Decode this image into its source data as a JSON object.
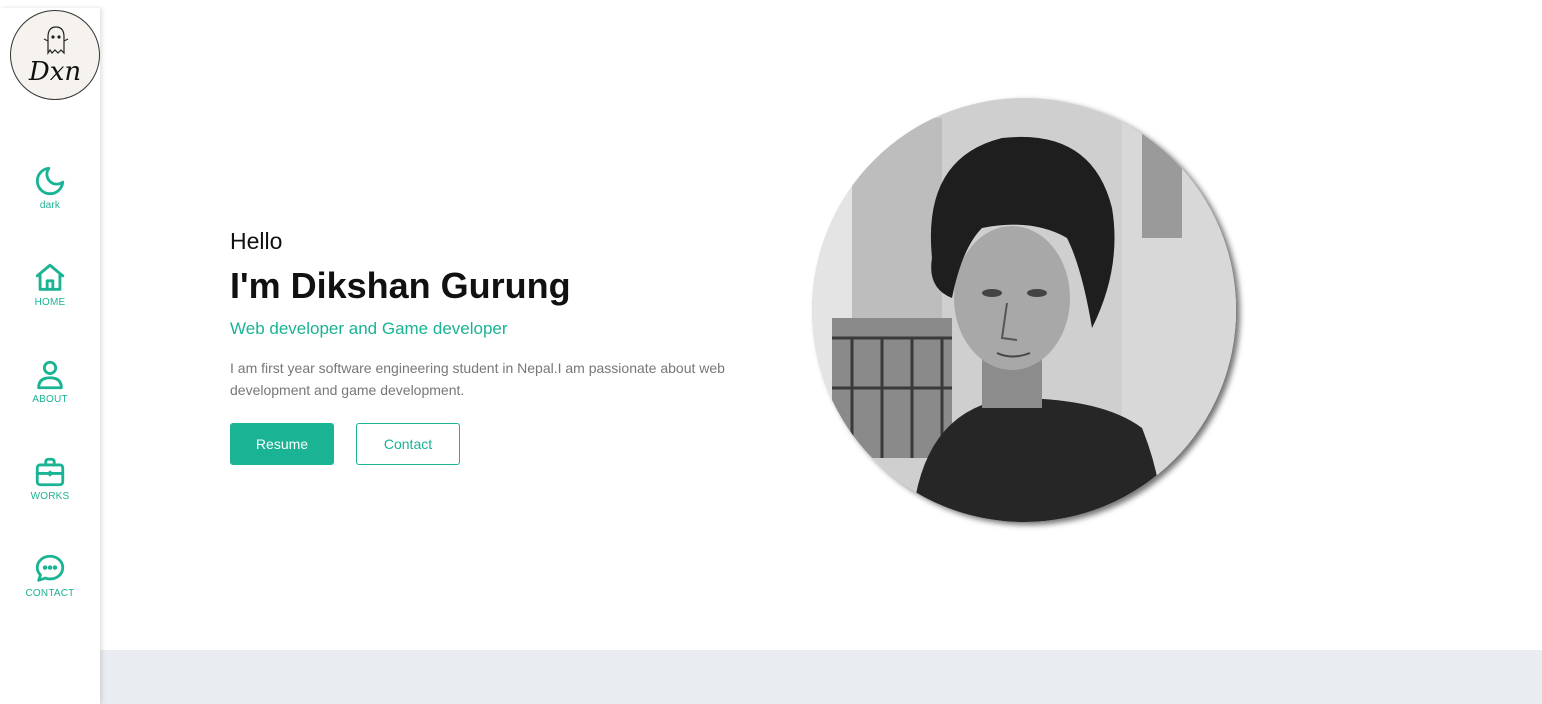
{
  "sidebar": {
    "logo_text": "Dxn",
    "items": [
      {
        "label": "dark",
        "icon": "moon-icon"
      },
      {
        "label": "HOME",
        "icon": "home-icon"
      },
      {
        "label": "ABOUT",
        "icon": "user-icon"
      },
      {
        "label": "WORKS",
        "icon": "briefcase-icon"
      },
      {
        "label": "CONTACT",
        "icon": "chat-icon"
      }
    ]
  },
  "hero": {
    "greeting": "Hello",
    "name": "I'm Dikshan Gurung",
    "role": "Web developer and Game developer",
    "bio": "I am first year software engineering student in Nepal.I am passionate about web development and game development.",
    "resume_label": "Resume",
    "contact_label": "Contact"
  },
  "colors": {
    "accent": "#1ab394",
    "footer_band": "#e9ecf0"
  }
}
